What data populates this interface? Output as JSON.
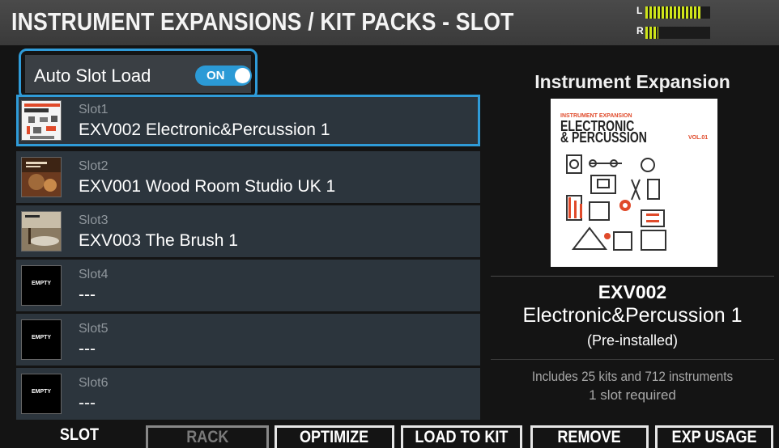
{
  "header": {
    "title": "INSTRUMENT EXPANSIONS / KIT PACKS - SLOT",
    "meter": {
      "left_label": "L",
      "right_label": "R",
      "left_level": 0.85,
      "right_level": 0.2
    }
  },
  "auto_slot_load": {
    "label": "Auto Slot Load",
    "toggle_state": "ON"
  },
  "slots": [
    {
      "num": "Slot1",
      "name": "EXV002 Electronic&Percussion 1",
      "thumb": "cover",
      "selected": true
    },
    {
      "num": "Slot2",
      "name": "EXV001  Wood Room Studio UK 1",
      "thumb": "cover",
      "selected": false
    },
    {
      "num": "Slot3",
      "name": "EXV003 The Brush 1",
      "thumb": "cover",
      "selected": false
    },
    {
      "num": "Slot4",
      "name": "---",
      "thumb": "EMPTY",
      "selected": false
    },
    {
      "num": "Slot5",
      "name": "---",
      "thumb": "EMPTY",
      "selected": false
    },
    {
      "num": "Slot6",
      "name": "---",
      "thumb": "EMPTY",
      "selected": false
    }
  ],
  "detail": {
    "header": "Instrument Expansion",
    "cover": {
      "line1": "INSTRUMENT EXPANSION",
      "line2": "ELECTRONIC",
      "line3": "& PERCUSSION",
      "vol": "VOL.01"
    },
    "code": "EXV002",
    "name": "Electronic&Percussion 1",
    "status": "(Pre-installed)",
    "includes": "Includes 25 kits and 712 instruments",
    "slots_required": "1 slot required"
  },
  "function_bar": {
    "slot": "SLOT",
    "rack": "RACK",
    "optimize": "OPTIMIZE",
    "load_to_kit": "LOAD TO KIT",
    "remove": "REMOVE",
    "exp_usage": "EXP USAGE"
  },
  "colors": {
    "accent": "#2f9bd8",
    "meter": "#cfe51a",
    "cover_red": "#e04a2a",
    "slot_bg": "#2c353d"
  }
}
